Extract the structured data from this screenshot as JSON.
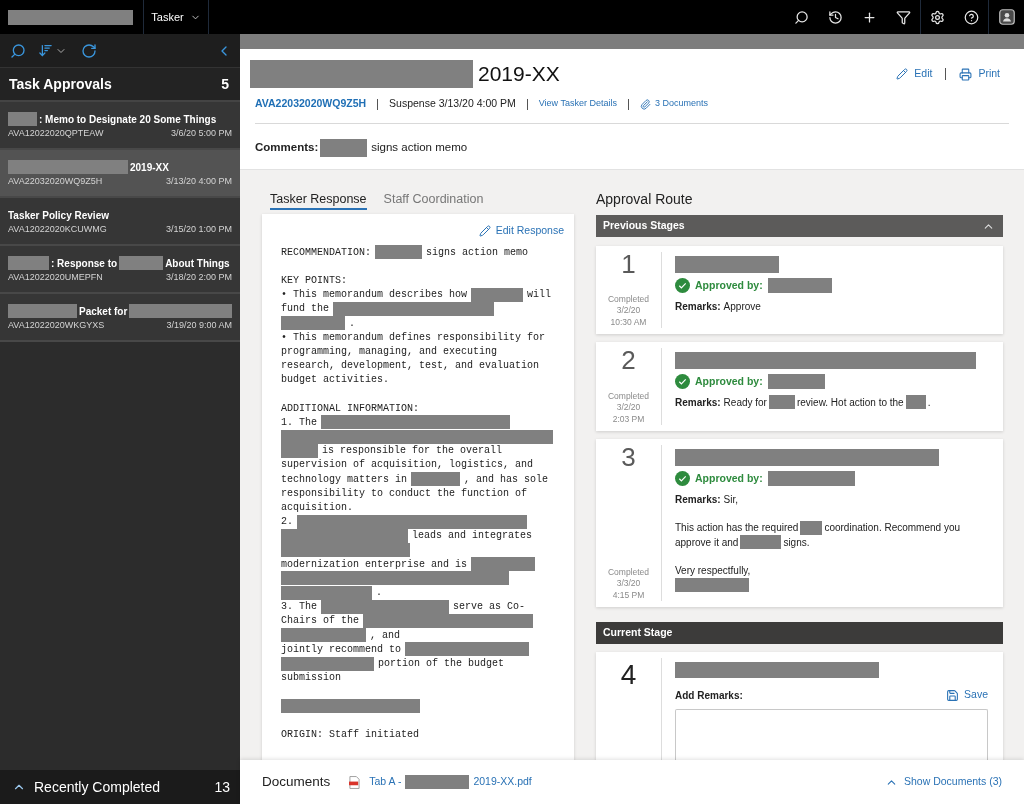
{
  "top_bar": {
    "brand": [
      {
        "kind": "redacted"
      }
    ],
    "app_menu": "Tasker"
  },
  "sidebar": {
    "title": "Task Approvals",
    "count": "5",
    "items": [
      {
        "title": [
          {
            "kind": "redacted"
          },
          {
            "kind": "text",
            "text": ": Memo to Designate 20 Some Things"
          }
        ],
        "id": "AVA12022020QPTEAW",
        "due": "3/6/20 5:00 PM",
        "selected": false
      },
      {
        "title": [
          {
            "kind": "redacted"
          },
          {
            "kind": "text",
            "text": "2019-XX"
          }
        ],
        "id": "AVA22032020WQ9Z5H",
        "due": "3/13/20 4:00 PM",
        "selected": true
      },
      {
        "title": [
          {
            "kind": "text",
            "text": "Tasker Policy Review"
          }
        ],
        "id": "AVA12022020KCUWMG",
        "due": "3/15/20 1:00 PM",
        "selected": false
      },
      {
        "title": [
          {
            "kind": "redacted"
          },
          {
            "kind": "text",
            "text": ": Response to"
          },
          {
            "kind": "redacted"
          },
          {
            "kind": "text",
            "text": "About Things"
          }
        ],
        "id": "AVA12022020UMEPFN",
        "due": "3/18/20 2:00 PM",
        "selected": false
      },
      {
        "title": [
          {
            "kind": "redacted"
          },
          {
            "kind": "text",
            "text": "Packet for"
          },
          {
            "kind": "redacted"
          }
        ],
        "id": "AVA12022020WKGYXS",
        "due": "3/19/20 9:00 AM",
        "selected": false
      }
    ],
    "footer": {
      "label": "Recently Completed",
      "count": "13",
      "expanded": false
    }
  },
  "task": {
    "title": [
      {
        "kind": "redacted"
      },
      {
        "kind": "text",
        "text": "2019-XX"
      }
    ],
    "actions": [
      {
        "kind": "edit",
        "label": "Edit"
      },
      {
        "kind": "print",
        "label": "Print"
      }
    ],
    "id": "AVA22032020WQ9Z5H",
    "suspense": "Suspense 3/13/20 4:00 PM",
    "details_link": "View Tasker Details",
    "documents_link": "3 Documents",
    "comments_label": "Comments:",
    "comments": [
      {
        "kind": "redacted"
      },
      {
        "kind": "text",
        "text": "signs action memo"
      }
    ]
  },
  "tabs": [
    {
      "label": "Tasker Response",
      "selected": true
    },
    {
      "label": "Staff Coordination",
      "selected": false
    }
  ],
  "response": {
    "action": "Edit Response",
    "blocks": [
      [
        [
          {
            "kind": "text",
            "text": "RECOMMENDATION:"
          },
          {
            "kind": "redacted"
          },
          {
            "kind": "text",
            "text": "signs action memo"
          }
        ]
      ],
      [
        [
          {
            "kind": "text",
            "text": "KEY POINTS:"
          }
        ],
        [
          {
            "kind": "text",
            "text": "• This memorandum describes how"
          },
          {
            "kind": "redacted"
          },
          {
            "kind": "text",
            "text": "will"
          }
        ],
        [
          {
            "kind": "text",
            "text": "fund the"
          },
          {
            "kind": "redacted"
          }
        ],
        [
          {
            "kind": "redacted"
          },
          {
            "kind": "text",
            "text": "."
          }
        ],
        [
          {
            "kind": "text",
            "text": "• This memorandum defines responsibility for"
          }
        ],
        [
          {
            "kind": "text",
            "text": "programming, managing, and executing"
          }
        ],
        [
          {
            "kind": "text",
            "text": "research, development, test, and evaluation"
          }
        ],
        [
          {
            "kind": "text",
            "text": "budget activities."
          }
        ]
      ],
      [
        [
          {
            "kind": "text",
            "text": "ADDITIONAL INFORMATION:"
          }
        ],
        [
          {
            "kind": "text",
            "text": "1. The"
          },
          {
            "kind": "redacted"
          }
        ],
        [
          {
            "kind": "redacted"
          }
        ],
        [
          {
            "kind": "redacted"
          },
          {
            "kind": "text",
            "text": "is responsible for the overall"
          }
        ],
        [
          {
            "kind": "text",
            "text": "supervision of acquisition, logistics, and"
          }
        ],
        [
          {
            "kind": "text",
            "text": "technology matters in"
          },
          {
            "kind": "redacted"
          },
          {
            "kind": "text",
            "text": ", and has sole"
          }
        ],
        [
          {
            "kind": "text",
            "text": "responsibility to conduct the function of"
          }
        ],
        [
          {
            "kind": "text",
            "text": "acquisition."
          }
        ],
        [
          {
            "kind": "text",
            "text": "2."
          },
          {
            "kind": "redacted"
          }
        ],
        [
          {
            "kind": "redacted"
          },
          {
            "kind": "text",
            "text": "leads and integrates"
          }
        ],
        [
          {
            "kind": "redacted"
          }
        ],
        [
          {
            "kind": "text",
            "text": "modernization enterprise and is"
          },
          {
            "kind": "redacted"
          }
        ],
        [
          {
            "kind": "redacted"
          }
        ],
        [
          {
            "kind": "redacted"
          },
          {
            "kind": "text",
            "text": "."
          }
        ],
        [
          {
            "kind": "text",
            "text": "3. The"
          },
          {
            "kind": "redacted"
          },
          {
            "kind": "text",
            "text": "serve as Co-"
          }
        ],
        [
          {
            "kind": "text",
            "text": "Chairs of the"
          },
          {
            "kind": "redacted"
          }
        ],
        [
          {
            "kind": "redacted"
          },
          {
            "kind": "text",
            "text": ", and"
          }
        ],
        [
          {
            "kind": "text",
            "text": "jointly recommend to"
          },
          {
            "kind": "redacted"
          }
        ],
        [
          {
            "kind": "redacted"
          },
          {
            "kind": "text",
            "text": "portion of the budget"
          }
        ],
        [
          {
            "kind": "text",
            "text": "submission"
          }
        ]
      ],
      [
        [
          {
            "kind": "redacted"
          }
        ]
      ],
      [
        [
          {
            "kind": "text",
            "text": "ORIGIN: Staff initiated"
          }
        ]
      ]
    ]
  },
  "approval_route": {
    "title": "Approval Route",
    "previous": {
      "title": "Previous Stages",
      "expanded": true,
      "stages": [
        {
          "number": "1",
          "status": "Completed",
          "date": "3/2/20",
          "time": "10:30 AM",
          "title": [
            {
              "kind": "redacted"
            }
          ],
          "approval": {
            "label": "Approved by:",
            "approved": true,
            "name": [
              {
                "kind": "redacted"
              }
            ]
          },
          "remarks_label": "Remarks:",
          "remarks": [
            [
              [
                {
                  "kind": "text",
                  "text": "Approve"
                }
              ]
            ]
          ]
        },
        {
          "number": "2",
          "status": "Completed",
          "date": "3/2/20",
          "time": "2:03 PM",
          "title": [
            {
              "kind": "redacted"
            }
          ],
          "approval": {
            "label": "Approved by:",
            "approved": true,
            "name": [
              {
                "kind": "redacted"
              }
            ]
          },
          "remarks_label": "Remarks:",
          "remarks": [
            [
              [
                {
                  "kind": "text",
                  "text": "Ready for"
                },
                {
                  "kind": "redacted"
                },
                {
                  "kind": "text",
                  "text": "review. Hot action to the"
                },
                {
                  "kind": "redacted"
                },
                {
                  "kind": "text",
                  "text": "."
                }
              ]
            ]
          ]
        },
        {
          "number": "3",
          "status": "Completed",
          "date": "3/3/20",
          "time": "4:15 PM",
          "title": [
            {
              "kind": "redacted"
            }
          ],
          "approval": {
            "label": "Approved by:",
            "approved": true,
            "name": [
              {
                "kind": "redacted"
              }
            ]
          },
          "remarks_label": "Remarks:",
          "remarks": [
            [
              [
                {
                  "kind": "text",
                  "text": "Sir,"
                }
              ]
            ],
            [
              [
                {
                  "kind": "text",
                  "text": "This action has the required"
                },
                {
                  "kind": "redacted"
                },
                {
                  "kind": "text",
                  "text": "coordination. Recommend you"
                }
              ],
              [
                {
                  "kind": "text",
                  "text": "approve it and"
                },
                {
                  "kind": "redacted"
                },
                {
                  "kind": "text",
                  "text": "signs."
                }
              ]
            ],
            [
              [
                {
                  "kind": "text",
                  "text": "Very respectfully,"
                }
              ],
              [
                {
                  "kind": "redacted"
                }
              ]
            ]
          ]
        }
      ]
    },
    "current": {
      "title": "Current Stage",
      "stage": {
        "number": "4",
        "title": [
          {
            "kind": "redacted"
          }
        ],
        "remarks_label": "Add Remarks:",
        "save": "Save"
      }
    }
  },
  "documents_bar": {
    "title": "Documents",
    "file": [
      {
        "kind": "text",
        "text": "Tab A -"
      },
      {
        "kind": "redacted"
      },
      {
        "kind": "text",
        "text": "2019-XX.pdf"
      }
    ],
    "toggle": "Show Documents (3)",
    "expanded": false
  }
}
